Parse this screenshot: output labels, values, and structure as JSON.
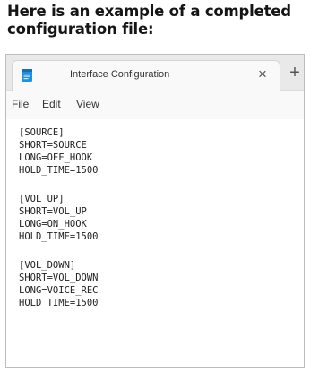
{
  "heading": "Here is an example of a completed configuration file:",
  "window": {
    "app_icon": "notepad-icon",
    "tab_title": "Interface Configuration",
    "close_symbol": "×",
    "new_tab_symbol": "+",
    "menu": [
      "File",
      "Edit",
      "View"
    ]
  },
  "file_lines": [
    "[SOURCE]",
    "SHORT=SOURCE",
    "LONG=OFF_HOOK",
    "HOLD_TIME=1500",
    "",
    "[VOL_UP]",
    "SHORT=VOL_UP",
    "LONG=ON_HOOK",
    "HOLD_TIME=1500",
    "",
    "[VOL_DOWN]",
    "SHORT=VOL_DOWN",
    "LONG=VOICE_REC",
    "HOLD_TIME=1500"
  ],
  "colors": {
    "tabbar": "#e9e9e9",
    "tab": "#f9f9f9",
    "icon_blue": "#1f8fe0",
    "text": "#222222"
  }
}
